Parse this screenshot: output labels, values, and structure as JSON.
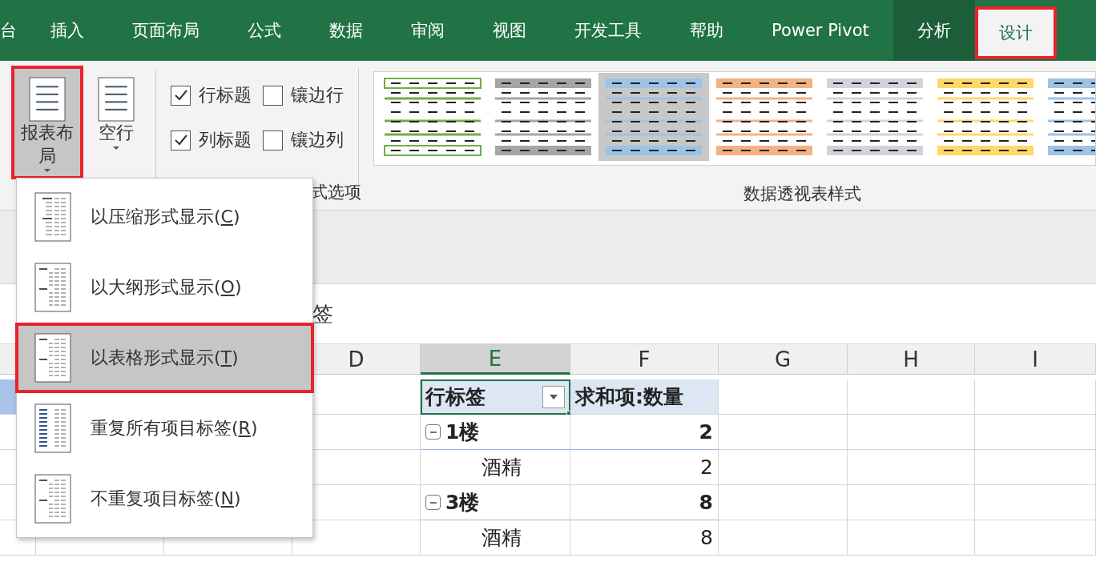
{
  "tabs": [
    {
      "label": "台",
      "kind": "normal",
      "selected": false
    },
    {
      "label": "插入",
      "kind": "normal",
      "selected": false
    },
    {
      "label": "页面布局",
      "kind": "normal",
      "selected": false
    },
    {
      "label": "公式",
      "kind": "normal",
      "selected": false
    },
    {
      "label": "数据",
      "kind": "normal",
      "selected": false
    },
    {
      "label": "审阅",
      "kind": "normal",
      "selected": false
    },
    {
      "label": "视图",
      "kind": "normal",
      "selected": false
    },
    {
      "label": "开发工具",
      "kind": "normal",
      "selected": false
    },
    {
      "label": "帮助",
      "kind": "normal",
      "selected": false
    },
    {
      "label": "Power Pivot",
      "kind": "normal",
      "selected": false
    },
    {
      "label": "分析",
      "kind": "contextual",
      "selected": false
    },
    {
      "label": "设计",
      "kind": "contextual",
      "selected": true
    }
  ],
  "ribbon": {
    "layout_buttons": [
      {
        "label": "报表布局",
        "kind": "layout",
        "selected": true
      },
      {
        "label": "空行",
        "kind": "blank",
        "selected": false
      }
    ],
    "options": [
      {
        "label": "行标题",
        "checked": true
      },
      {
        "label": "镶边行",
        "checked": false
      },
      {
        "label": "列标题",
        "checked": true
      },
      {
        "label": "镶边列",
        "checked": false
      }
    ],
    "options_group_label": "式选项",
    "styles": [
      {
        "color": "#70ad47",
        "selected": false
      },
      {
        "color": "#a5a5a5",
        "selected": false
      },
      {
        "color": "#9dc3e6",
        "selected": true
      },
      {
        "color": "#f4b183",
        "selected": false
      },
      {
        "color": "#d0d4da",
        "selected": false
      },
      {
        "color": "#ffd966",
        "selected": false
      },
      {
        "color": "#9dc3e6",
        "selected": false
      }
    ],
    "styles_group_label": "数据透视表样式"
  },
  "formula_bar": {
    "value": "签"
  },
  "menu": {
    "items": [
      {
        "kind": "compact",
        "before": "以压缩形式显示(",
        "key": "C",
        "after": ")",
        "selected": false
      },
      {
        "kind": "outline",
        "before": "以大纲形式显示(",
        "key": "O",
        "after": ")",
        "selected": false
      },
      {
        "kind": "tabular",
        "before": "以表格形式显示(",
        "key": "T",
        "after": ")",
        "selected": true
      },
      {
        "kind": "repeat",
        "before": "重复所有项目标签(",
        "key": "R",
        "after": ")",
        "selected": false
      },
      {
        "kind": "norepeat",
        "before": "不重复项目标签(",
        "key": "N",
        "after": ")",
        "selected": false
      }
    ]
  },
  "sheet": {
    "columns": [
      {
        "label": "D",
        "selected": false
      },
      {
        "label": "E",
        "selected": true
      },
      {
        "label": "F",
        "selected": false
      },
      {
        "label": "G",
        "selected": false
      },
      {
        "label": "H",
        "selected": false
      },
      {
        "label": "I",
        "selected": false
      }
    ],
    "pivot": {
      "header_label": "行标签",
      "header_value": "求和项:数量",
      "rows": [
        {
          "kind": "group",
          "label": "1楼",
          "value": "2",
          "expanded": true
        },
        {
          "kind": "item",
          "label": "酒精",
          "value": "2"
        },
        {
          "kind": "group",
          "label": "3楼",
          "value": "8",
          "expanded": true
        },
        {
          "kind": "item",
          "label": "酒精",
          "value": "8"
        }
      ]
    }
  }
}
